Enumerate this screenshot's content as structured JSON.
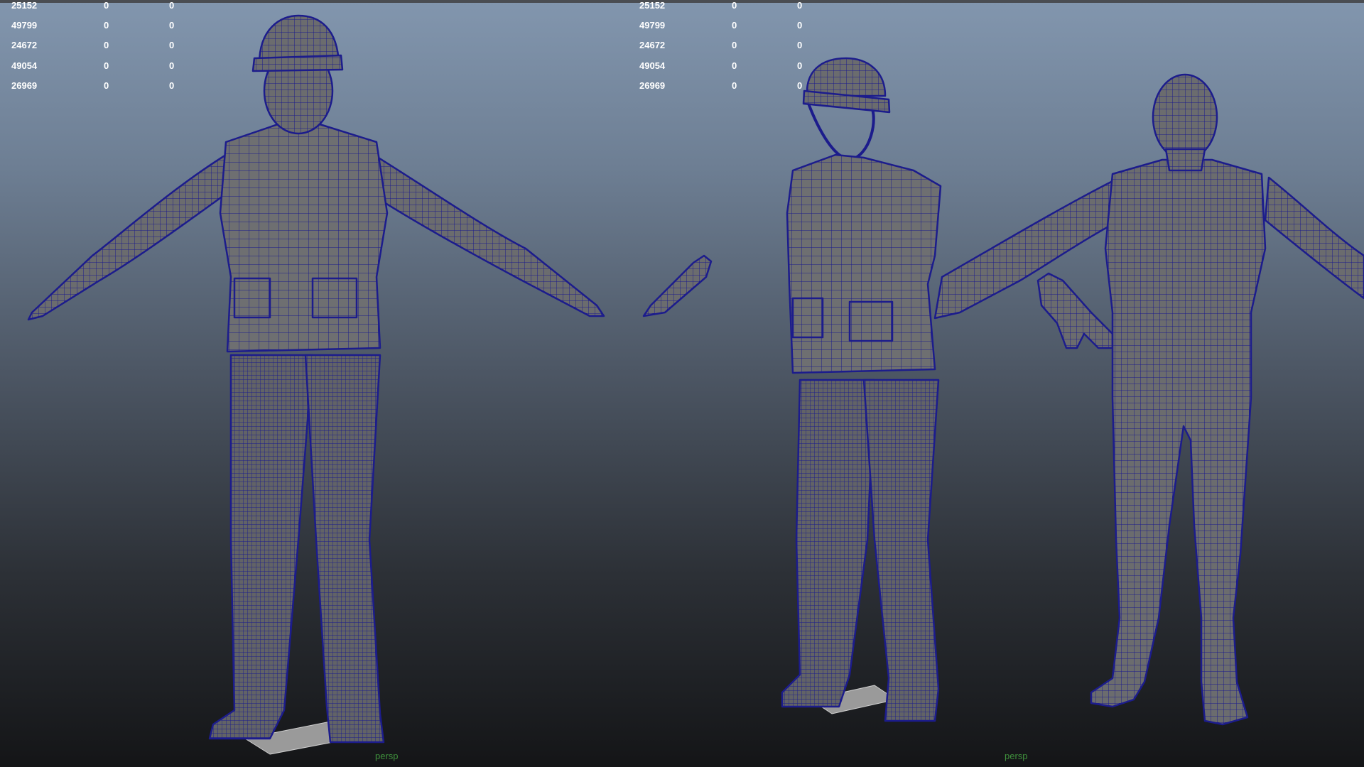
{
  "viewports": [
    {
      "id": "left",
      "camera": "persp",
      "stats": [
        [
          "25152",
          "0",
          "0"
        ],
        [
          "49799",
          "0",
          "0"
        ],
        [
          "24672",
          "0",
          "0"
        ],
        [
          "49054",
          "0",
          "0"
        ],
        [
          "26969",
          "0",
          "0"
        ]
      ]
    },
    {
      "id": "right",
      "camera": "persp",
      "stats": [
        [
          "25152",
          "0",
          "0"
        ],
        [
          "49799",
          "0",
          "0"
        ],
        [
          "24672",
          "0",
          "0"
        ],
        [
          "49054",
          "0",
          "0"
        ],
        [
          "26969",
          "0",
          "0"
        ]
      ]
    }
  ],
  "colors": {
    "mesh_fill": "#6b6c6e",
    "wireframe": "#1c1c8c",
    "hud_text": "#ffffff",
    "camera_label": "#3f8f3c"
  }
}
